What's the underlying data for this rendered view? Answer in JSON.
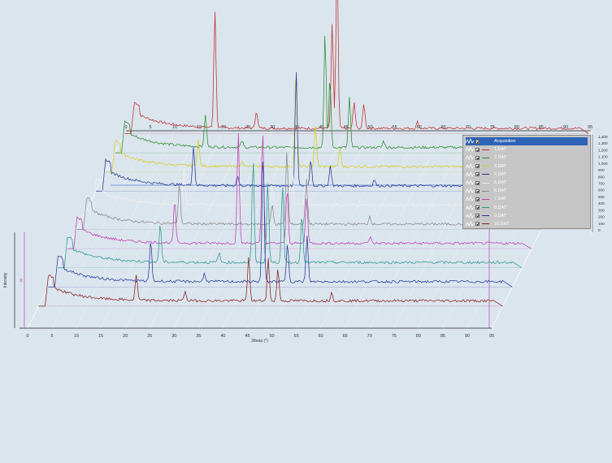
{
  "chart_data": {
    "type": "line",
    "title": "",
    "xlabel": "2theta (°)",
    "ylabel": "Intensity",
    "front_x_ticks": [
      "0",
      "5",
      "10",
      "15",
      "20",
      "25",
      "30",
      "35",
      "40",
      "45",
      "50",
      "55",
      "60",
      "65",
      "70",
      "75",
      "80",
      "85",
      "90",
      "95"
    ],
    "back_x_ticks": [
      "0",
      "5",
      "10",
      "15",
      "20",
      "25",
      "30",
      "35",
      "40",
      "45",
      "50",
      "55",
      "60",
      "65",
      "70",
      "75",
      "80",
      "85",
      "90",
      "95"
    ],
    "z_ticks": [
      "1,400",
      "1,300",
      "1,200",
      "1,100",
      "1,000",
      "900",
      "800",
      "700",
      "600",
      "500",
      "400",
      "300",
      "200",
      "100",
      "0"
    ],
    "y_marker": "0",
    "xlim": [
      0,
      95
    ],
    "zlim": [
      0,
      1400
    ],
    "grid": true,
    "legend_position": "top-right",
    "cursor_2theta": 94.5,
    "series": [
      {
        "name": "1.DAT",
        "color": "#c03030",
        "peaks": [
          [
            18.5,
            720
          ],
          [
            27,
            110
          ],
          [
            43.5,
            1050
          ],
          [
            42.5,
            640
          ],
          [
            47,
            160
          ],
          [
            49,
            150
          ],
          [
            60,
            40
          ]
        ]
      },
      {
        "name": "2.DAT",
        "color": "#2e8b2e",
        "peaks": [
          [
            18.5,
            200
          ],
          [
            44,
            430
          ],
          [
            43,
            700
          ],
          [
            48,
            310
          ],
          [
            26,
            40
          ],
          [
            55,
            40
          ]
        ]
      },
      {
        "name": "3.DAT",
        "color": "#d8d020",
        "peaks": [
          [
            19,
            160
          ],
          [
            39,
            620
          ],
          [
            43,
            260
          ],
          [
            48,
            120
          ],
          [
            28,
            40
          ]
        ]
      },
      {
        "name": "4.DAT",
        "color": "#2a3a9a",
        "peaks": [
          [
            20,
            240
          ],
          [
            41,
            700
          ],
          [
            44,
            160
          ],
          [
            48,
            120
          ],
          [
            29,
            60
          ],
          [
            57,
            40
          ]
        ]
      },
      {
        "name": "5.DAT",
        "color": "#f0f0f0",
        "peaks": [
          [
            20,
            230
          ],
          [
            42,
            430
          ],
          [
            45,
            220
          ],
          [
            38,
            130
          ]
        ]
      },
      {
        "name": "6.DAT",
        "color": "#8a8a8a",
        "peaks": [
          [
            21,
            250
          ],
          [
            43,
            450
          ],
          [
            47,
            280
          ],
          [
            40,
            120
          ],
          [
            60,
            50
          ]
        ]
      },
      {
        "name": "7.DAT",
        "color": "#c040b0",
        "peaks": [
          [
            22,
            260
          ],
          [
            35,
            700
          ],
          [
            40,
            700
          ],
          [
            45,
            340
          ],
          [
            49,
            290
          ],
          [
            62,
            40
          ]
        ]
      },
      {
        "name": "8.DAT",
        "color": "#2a9a8a",
        "peaks": [
          [
            21,
            240
          ],
          [
            40,
            640
          ],
          [
            43,
            500
          ],
          [
            46,
            480
          ],
          [
            50,
            300
          ],
          [
            33,
            60
          ]
        ]
      },
      {
        "name": "9.DAT",
        "color": "#27389a",
        "peaks": [
          [
            21,
            250
          ],
          [
            44,
            800
          ],
          [
            53,
            280
          ],
          [
            49,
            240
          ],
          [
            32,
            50
          ]
        ]
      },
      {
        "name": "10.DAT",
        "color": "#8a2020",
        "peaks": [
          [
            20,
            160
          ],
          [
            43,
            280
          ],
          [
            47,
            260
          ],
          [
            49,
            200
          ],
          [
            30,
            60
          ],
          [
            60,
            50
          ]
        ]
      }
    ]
  },
  "legend": {
    "header": "Acquisition",
    "items": [
      "1.DAT",
      "2.DAT",
      "3.DAT",
      "4.DAT",
      "5.DAT",
      "6.DAT",
      "7.DAT",
      "8.DAT",
      "9.DAT",
      "10.DAT"
    ],
    "colors": [
      "#c03030",
      "#2e8b2e",
      "#d8d020",
      "#2a3a9a",
      "#f0f0f0",
      "#8a8a8a",
      "#c040b0",
      "#2a9a8a",
      "#27389a",
      "#8a2020"
    ]
  }
}
